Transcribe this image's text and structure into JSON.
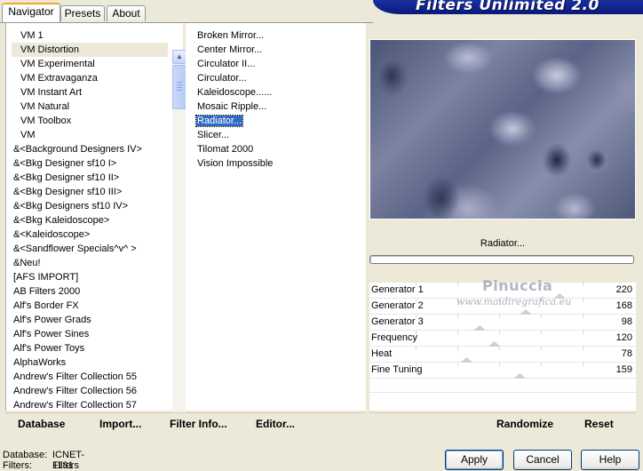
{
  "tabs": [
    {
      "label": "Navigator"
    },
    {
      "label": "Presets"
    },
    {
      "label": "About"
    }
  ],
  "banner": {
    "title": "Filters Unlimited 2.0"
  },
  "categories": [
    {
      "label": "VM 1"
    },
    {
      "label": "VM Distortion"
    },
    {
      "label": "VM Experimental"
    },
    {
      "label": "VM Extravaganza"
    },
    {
      "label": "VM Instant Art"
    },
    {
      "label": "VM Natural"
    },
    {
      "label": "VM Toolbox"
    },
    {
      "label": "VM"
    },
    {
      "label": "&<Background Designers IV>"
    },
    {
      "label": "&<Bkg Designer sf10 I>"
    },
    {
      "label": "&<Bkg Designer sf10 II>"
    },
    {
      "label": "&<Bkg Designer sf10 III>"
    },
    {
      "label": "&<Bkg Designers sf10 IV>"
    },
    {
      "label": "&<Bkg Kaleidoscope>"
    },
    {
      "label": "&<Kaleidoscope>"
    },
    {
      "label": "&<Sandflower Specials^v^ >"
    },
    {
      "label": "&Neu!"
    },
    {
      "label": "[AFS IMPORT]"
    },
    {
      "label": "AB Filters 2000"
    },
    {
      "label": "Alf's Border FX"
    },
    {
      "label": "Alf's Power Grads"
    },
    {
      "label": "Alf's Power Sines"
    },
    {
      "label": "Alf's Power Toys"
    },
    {
      "label": "AlphaWorks"
    },
    {
      "label": "Andrew's Filter Collection 55"
    },
    {
      "label": "Andrew's Filter Collection 56"
    },
    {
      "label": "Andrew's Filter Collection 57"
    }
  ],
  "filters": [
    {
      "label": "Broken Mirror..."
    },
    {
      "label": "Center Mirror..."
    },
    {
      "label": "Circulator II..."
    },
    {
      "label": "Circulator..."
    },
    {
      "label": "Kaleidoscope......"
    },
    {
      "label": "Mosaic Ripple..."
    },
    {
      "label": "Radiator..."
    },
    {
      "label": "Slicer..."
    },
    {
      "label": "Tilomat 2000"
    },
    {
      "label": "Vision Impossible"
    }
  ],
  "scrollbar": {
    "up_icon": "▲",
    "down_icon": "▼"
  },
  "selected_filter_name": "Radiator...",
  "params": [
    {
      "label": "Generator 1",
      "value": "220",
      "level": 0.863
    },
    {
      "label": "Generator 2",
      "value": "168",
      "level": 0.659
    },
    {
      "label": "Generator 3",
      "value": "98",
      "level": 0.384
    },
    {
      "label": "Frequency",
      "value": "120",
      "level": 0.471
    },
    {
      "label": "Heat",
      "value": "78",
      "level": 0.306
    },
    {
      "label": "Fine Tuning",
      "value": "159",
      "level": 0.624
    }
  ],
  "watermark": {
    "name": "Pinuccia",
    "site": "www.maidiregrafica.eu"
  },
  "left_actions": {
    "database": "Database",
    "import": "Import...",
    "filter_info": "Filter Info...",
    "editor": "Editor..."
  },
  "right_actions": {
    "randomize": "Randomize",
    "reset": "Reset"
  },
  "status": {
    "database_label": "Database:",
    "database_value": "ICNET-Filters",
    "filters_label": "Filters:",
    "filters_value": "1131"
  },
  "buttons": {
    "apply": "Apply",
    "cancel": "Cancel",
    "help": "Help"
  }
}
